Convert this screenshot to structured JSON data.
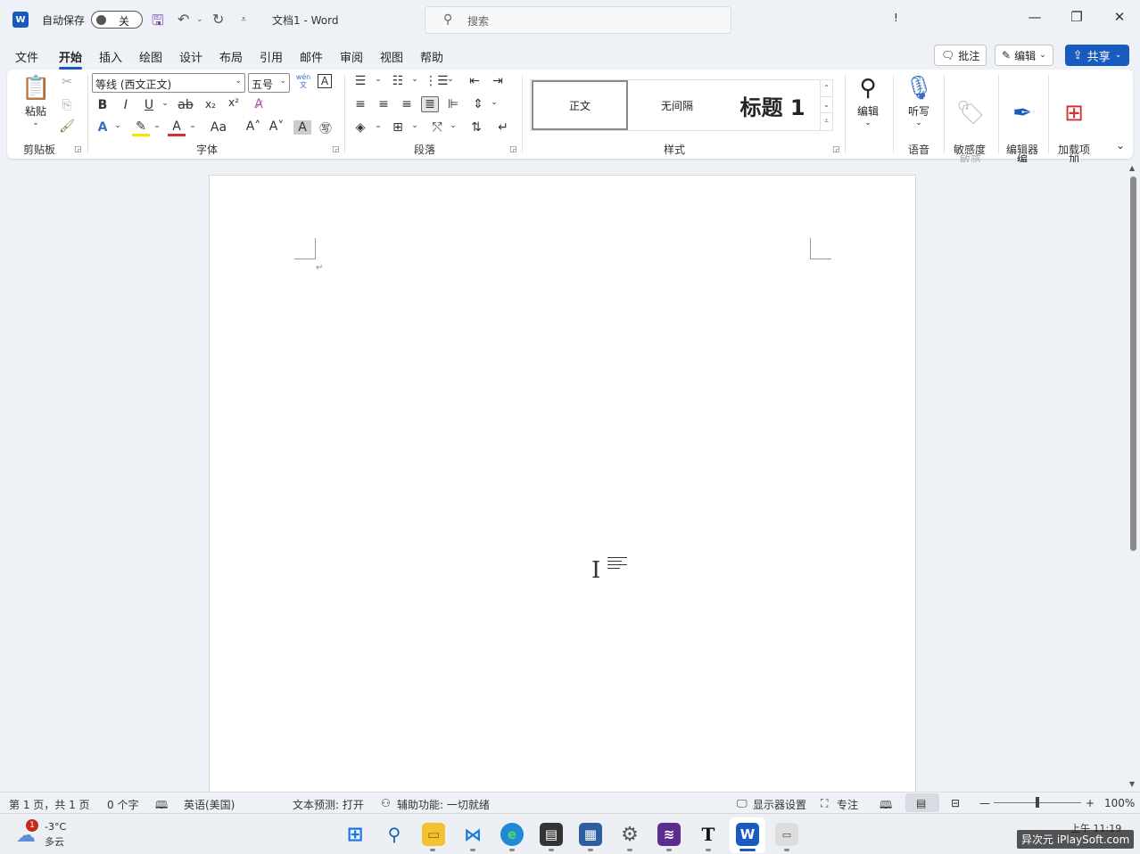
{
  "titlebar": {
    "app_logo": "W",
    "autosave_label": "自动保存",
    "autosave_state": "关",
    "doc_title": "文档1  -  Word",
    "search_placeholder": "搜索",
    "warning": "!",
    "min": "—",
    "restore": "❐",
    "close": "✕"
  },
  "menu": {
    "tabs": [
      "文件",
      "开始",
      "插入",
      "绘图",
      "设计",
      "布局",
      "引用",
      "邮件",
      "审阅",
      "视图",
      "帮助"
    ],
    "comment_label": "批注",
    "edit_label": "编辑",
    "share_label": "共享"
  },
  "ribbon": {
    "clipboard": {
      "paste": "粘贴",
      "label": "剪贴板"
    },
    "font": {
      "name": "等线 (西文正文)",
      "size": "五号",
      "label": "字体",
      "bold": "B",
      "italic": "I",
      "underline": "U",
      "strike": "ab",
      "sub": "x₂",
      "sup": "x²",
      "case": "Aa",
      "grow": "A˄",
      "shrink": "A˅",
      "wen": "wén\n文",
      "A_box": "A"
    },
    "paragraph": {
      "label": "段落"
    },
    "styles": {
      "items": [
        "正文",
        "无间隔",
        "标题 1"
      ],
      "label": "样式"
    },
    "editing": {
      "label": "编辑"
    },
    "dictate": {
      "label": "听写",
      "group": "语音"
    },
    "sensitivity": {
      "label": "敏感\n性",
      "group": "敏感度"
    },
    "editor": {
      "label": "编\n辑器",
      "group": "编辑器"
    },
    "addins": {
      "label": "加\n载项",
      "group": "加载项"
    }
  },
  "document": {
    "paragraph_mark": "↵"
  },
  "statusbar": {
    "page": "第 1 页，共 1 页",
    "words": "0 个字",
    "language": "英语(美国)",
    "prediction": "文本预测: 打开",
    "accessibility": "辅助功能: 一切就绪",
    "display": "显示器设置",
    "focus": "专注",
    "zoom": "100%",
    "zoom_minus": "—",
    "zoom_plus": "+"
  },
  "taskbar": {
    "weather_badge": "1",
    "temp": "-3°C",
    "weather": "多云",
    "clock": "上午 11:19",
    "watermark": "异次元 iPlaySoft.com"
  },
  "colors": {
    "accent": "#185abd",
    "ribbon_bg": "#ffffff",
    "window_bg": "#eef1f6"
  }
}
